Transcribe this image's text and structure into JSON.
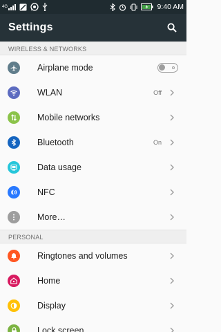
{
  "statusbar": {
    "network_label": "4G",
    "time": "9:40 AM",
    "icons_left": [
      "signal-icon",
      "no-sim-icon",
      "whatsapp-icon",
      "usb-icon"
    ],
    "icons_right": [
      "bluetooth-icon",
      "alarm-icon",
      "vibrate-icon",
      "battery-charging-icon"
    ]
  },
  "appbar": {
    "title": "Settings",
    "search_icon": "search-icon"
  },
  "sections": [
    {
      "header": "WIRELESS & NETWORKS",
      "items": [
        {
          "label": "Airplane mode",
          "icon": "airplane-icon",
          "color": "#607d8b",
          "control": "toggle",
          "toggle_on": false
        },
        {
          "label": "WLAN",
          "icon": "wifi-icon",
          "color": "#5c6bc0",
          "status": "Off",
          "control": "chevron"
        },
        {
          "label": "Mobile networks",
          "icon": "mobile-data-icon",
          "color": "#8bc34a",
          "control": "chevron"
        },
        {
          "label": "Bluetooth",
          "icon": "bluetooth-icon",
          "color": "#1565c0",
          "status": "On",
          "control": "chevron"
        },
        {
          "label": "Data usage",
          "icon": "data-usage-icon",
          "color": "#26c6da",
          "control": "chevron"
        },
        {
          "label": "NFC",
          "icon": "nfc-icon",
          "color": "#2979ff",
          "control": "chevron"
        },
        {
          "label": "More…",
          "icon": "more-icon",
          "color": "#9e9e9e",
          "control": "chevron"
        }
      ]
    },
    {
      "header": "PERSONAL",
      "items": [
        {
          "label": "Ringtones and volumes",
          "icon": "bell-icon",
          "color": "#ff5722",
          "control": "chevron"
        },
        {
          "label": "Home",
          "icon": "home-icon",
          "color": "#d81b60",
          "control": "chevron"
        },
        {
          "label": "Display",
          "icon": "display-icon",
          "color": "#ffc107",
          "control": "chevron"
        },
        {
          "label": "Lock screen",
          "icon": "lock-icon",
          "color": "#7cb342",
          "control": "chevron"
        }
      ]
    }
  ]
}
